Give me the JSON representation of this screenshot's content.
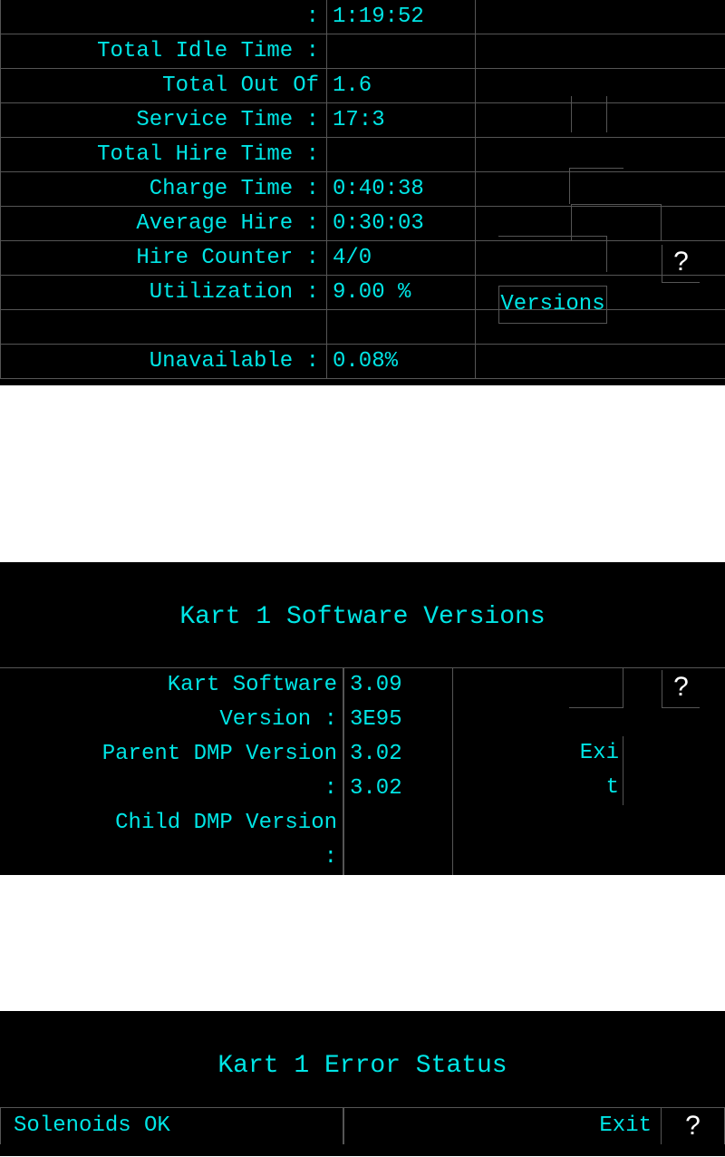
{
  "panel1": {
    "rows": [
      {
        "label": ":",
        "value": "1:19:52"
      },
      {
        "label": "Total Idle Time :",
        "value": ""
      },
      {
        "label": "Total Out Of",
        "value": "1.6"
      },
      {
        "label": "Service Time :",
        "value": "17:3"
      },
      {
        "label": "Total Hire Time :",
        "value": ""
      },
      {
        "label": "Charge Time :",
        "value": "0:40:38"
      },
      {
        "label": "Average Hire :",
        "value": "0:30:03"
      },
      {
        "label": "Hire Counter :",
        "value": "4/0"
      },
      {
        "label": "Utilization :",
        "value": "9.00 %"
      },
      {
        "label": "",
        "value": ""
      },
      {
        "label": "Unavailable :",
        "value": "0.08%"
      }
    ],
    "versions_button": "Versions",
    "help": "?"
  },
  "panel2": {
    "title": "Kart 1 Software Versions",
    "labels": "Kart Software\nVersion :\nParent DMP Version\n:\nChild DMP Version\n:",
    "values": "3.09\n3E95\n3.02\n3.02",
    "exit": "Exit",
    "help": "?"
  },
  "panel3": {
    "title": "Kart 1 Error Status",
    "status": "Solenoids OK",
    "exit": "Exit",
    "help": "?"
  }
}
